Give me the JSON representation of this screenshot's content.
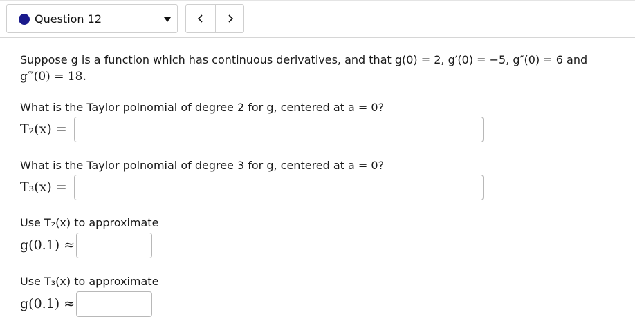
{
  "header": {
    "question_label": "Question 12",
    "status_color": "#1a1a8c",
    "prev_icon": "chevron-left-icon",
    "next_icon": "chevron-right-icon"
  },
  "problem": {
    "intro_text": "Suppose g is a function which has continuous derivatives, and that g(0) = 2, g′(0) = −5, g″(0) = 6 and",
    "intro_line2": "g‴(0) = 18."
  },
  "parts": [
    {
      "prompt": "What is the Taylor polnomial of degree 2 for g, centered at a = 0?",
      "label": "T₂(x) =",
      "value": "",
      "placeholder": ""
    },
    {
      "prompt": "What is the Taylor polnomial of degree 3 for g, centered at a = 0?",
      "label": "T₃(x) =",
      "value": "",
      "placeholder": ""
    },
    {
      "prompt": "Use T₂(x) to approximate",
      "label": "g(0.1) ≈",
      "value": "",
      "placeholder": ""
    },
    {
      "prompt": "Use T₃(x) to approximate",
      "label": "g(0.1) ≈",
      "value": "",
      "placeholder": ""
    }
  ]
}
